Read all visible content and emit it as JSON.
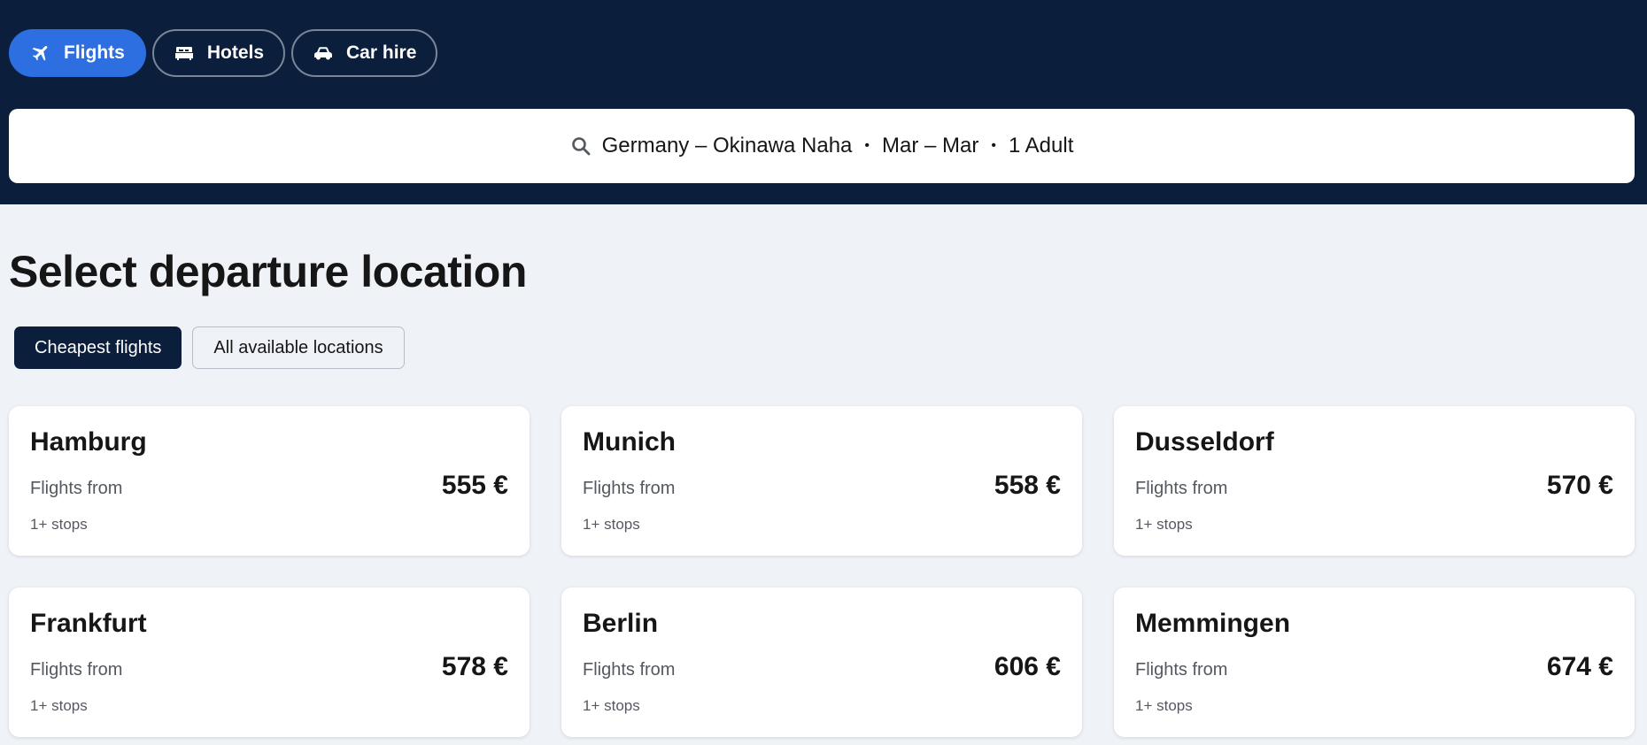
{
  "nav": {
    "tabs": [
      {
        "label": "Flights",
        "icon": "plane-icon",
        "active": true
      },
      {
        "label": "Hotels",
        "icon": "bed-icon",
        "active": false
      },
      {
        "label": "Car hire",
        "icon": "car-icon",
        "active": false
      }
    ]
  },
  "search": {
    "route": "Germany – Okinawa Naha",
    "dates": "Mar – Mar",
    "travellers": "1 Adult",
    "separator": "•"
  },
  "page": {
    "title": "Select departure location"
  },
  "filters": [
    {
      "label": "Cheapest flights",
      "active": true
    },
    {
      "label": "All available locations",
      "active": false
    }
  ],
  "results": [
    {
      "city": "Hamburg",
      "from_label": "Flights from",
      "price": "555 €",
      "stops": "1+ stops"
    },
    {
      "city": "Munich",
      "from_label": "Flights from",
      "price": "558 €",
      "stops": "1+ stops"
    },
    {
      "city": "Dusseldorf",
      "from_label": "Flights from",
      "price": "570 €",
      "stops": "1+ stops"
    },
    {
      "city": "Frankfurt",
      "from_label": "Flights from",
      "price": "578 €",
      "stops": "1+ stops"
    },
    {
      "city": "Berlin",
      "from_label": "Flights from",
      "price": "606 €",
      "stops": "1+ stops"
    },
    {
      "city": "Memmingen",
      "from_label": "Flights from",
      "price": "674 €",
      "stops": "1+ stops"
    }
  ],
  "colors": {
    "header_bg": "#0b1f3d",
    "accent": "#2d6fe0",
    "page_bg": "#eff3f8"
  }
}
